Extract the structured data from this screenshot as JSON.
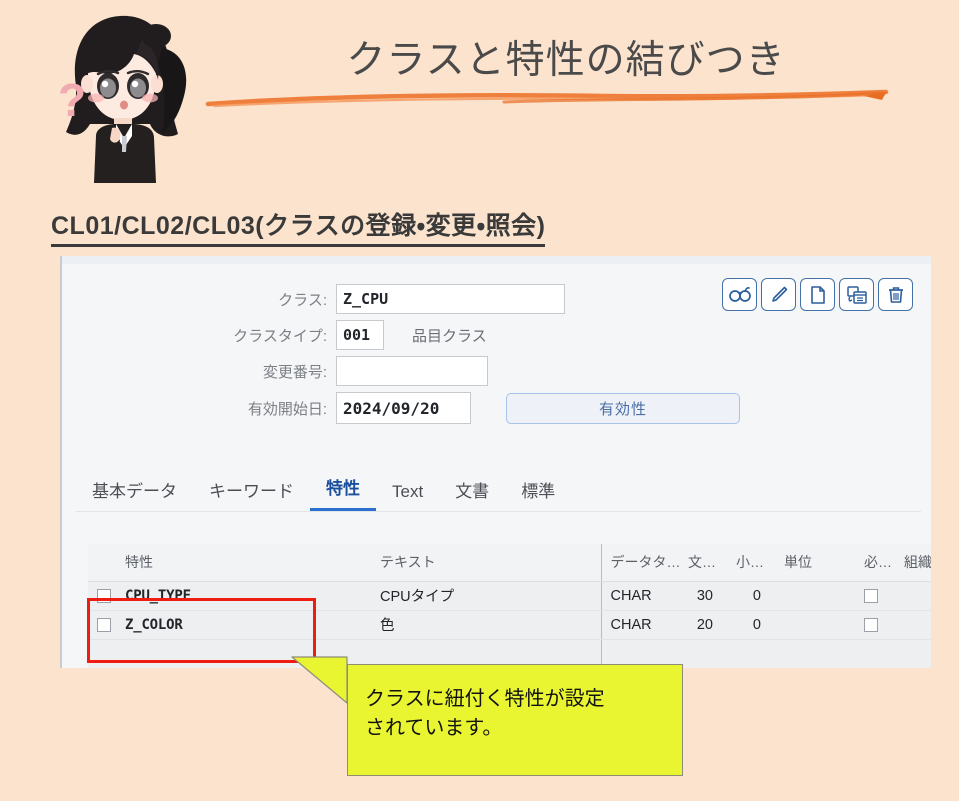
{
  "page": {
    "background_color": "#fbe3cd",
    "title": "クラスと特性の結びつき",
    "section_heading": "CL01/CL02/CL03(クラスの登録・変更・照会)"
  },
  "mascot": {
    "name": "chibi-business-girl-illustration",
    "question_mark": "?"
  },
  "form": {
    "rows": [
      {
        "label": "クラス:",
        "value": "Z_CPU",
        "name": "class"
      },
      {
        "label": "クラスタイプ:",
        "value": "001",
        "name": "class-type",
        "description": "品目クラス"
      },
      {
        "label": "変更番号:",
        "value": "",
        "name": "change-number"
      },
      {
        "label": "有効開始日:",
        "value": "2024/09/20",
        "name": "valid-from"
      }
    ],
    "validity_button": "有効性"
  },
  "toolbar": {
    "buttons": [
      {
        "name": "display-glasses-icon",
        "label": "表示"
      },
      {
        "name": "edit-pencil-icon",
        "label": "変更"
      },
      {
        "name": "create-document-icon",
        "label": "新規"
      },
      {
        "name": "copy-template-icon",
        "label": "コピー"
      },
      {
        "name": "delete-trash-icon",
        "label": "削除"
      }
    ],
    "accent_color": "#4472a8"
  },
  "tabs": [
    {
      "label": "基本データ",
      "active": false
    },
    {
      "label": "キーワード",
      "active": false
    },
    {
      "label": "特性",
      "active": true
    },
    {
      "label": "Text",
      "active": false
    },
    {
      "label": "文書",
      "active": false
    },
    {
      "label": "標準",
      "active": false
    }
  ],
  "tab_active_color": "#2b6fd0",
  "table": {
    "columns": [
      "特性",
      "テキスト",
      "データタ…",
      "文…",
      "小…",
      "単位",
      "必…",
      "組織"
    ],
    "rows": [
      {
        "selected": false,
        "characteristic": "CPU_TYPE",
        "text": "CPUタイプ",
        "data_type": "CHAR",
        "length": "30",
        "decimals": "0",
        "unit": "",
        "required": false,
        "org": ""
      },
      {
        "selected": false,
        "characteristic": "Z_COLOR",
        "text": "色",
        "data_type": "CHAR",
        "length": "20",
        "decimals": "0",
        "unit": "",
        "required": false,
        "org": ""
      }
    ]
  },
  "annotation": {
    "highlight_color": "#ee1c11",
    "callout_color": "#eaf531",
    "callout_text": "クラスに紐付く特性が設定\nされています。"
  }
}
